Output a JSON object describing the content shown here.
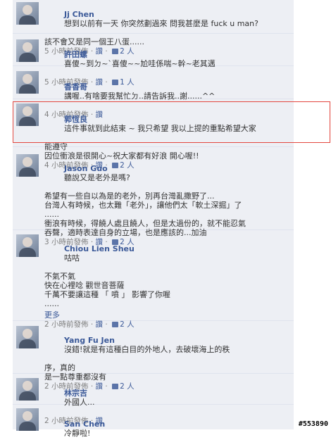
{
  "comments": [
    {
      "name": "Jj Chen",
      "lines": [
        "想到以前有一天 你突然劃過來 問我甚麼是 fuck u man?",
        "該不會又是同一個王八蛋......"
      ],
      "time": "5 小時前發佈",
      "sep": " · ",
      "action": "讚",
      "likes": "2 人"
    },
    {
      "name": "許田螺",
      "lines": [
        "喜傻~到ㄉ~`喜傻~~尬哇係喘~幹~老其邁"
      ],
      "time": "5 小時前發佈",
      "sep": " · ",
      "action": "讚",
      "likes": "1 人"
    },
    {
      "name": "香香哥",
      "lines": [
        "講喔..有啥要我幫忙ㄉ..請告訴我..謝......^^"
      ],
      "time": "4 小時前發佈",
      "sep": " · ",
      "action": "讚"
    },
    {
      "name": "郭恆良",
      "lines": [
        "這件事就到此結束 ~ 我只希望 我以上提的重點希望大家",
        "能遵守",
        "因位衝浪是很開心~祝大家都有好浪 開心喔!!"
      ],
      "time": "4 小時前發佈",
      "sep": " · ",
      "action": "讚",
      "likes": "2 人"
    },
    {
      "name": "Jason Guo",
      "lines": [
        "聽說又是老外是嗎?",
        "希望有一些自以為是的老外，別再台灣亂撒野了...",
        "台灣人有時候，也太難「老外」，讓他們太「軟土深掘」了",
        "......",
        "衝浪有時候，得饒人處且饒人，但是太過份的，就不能忍氣",
        "吞聲，適時表達自身的立場，也是應該的...加油"
      ],
      "time": "3 小時前發佈",
      "sep": " · ",
      "action": "讚",
      "likes": "2 人"
    },
    {
      "name": "Chiou Lien Sheu",
      "lines": [
        "咕咕",
        "不氣不氣",
        "快在心裡唸 觀世音菩薩",
        "",
        "千萬不要讓這種 「 噴 」 影響了你喔",
        "......"
      ],
      "more": "更多",
      "time": "2 小時前發佈",
      "sep": " · ",
      "action": "讚",
      "likes": "2 人"
    },
    {
      "name": "Yang Fu Jen",
      "lines": [
        "沒錯!就是有這種白目的外地人，去破壞海上的秩",
        "序，真的",
        "是一點尊重都沒有"
      ],
      "time": "2 小時前發佈",
      "sep": " · ",
      "action": "讚",
      "likes": "2 人"
    },
    {
      "name": "林宗吉",
      "lines": [
        "外國人..."
      ],
      "time": "2 小時前發佈",
      "sep": " · ",
      "action": "讚"
    },
    {
      "name": "San Chen",
      "lines": [
        "冷靜啦!"
      ]
    }
  ],
  "watermark": "#553890"
}
